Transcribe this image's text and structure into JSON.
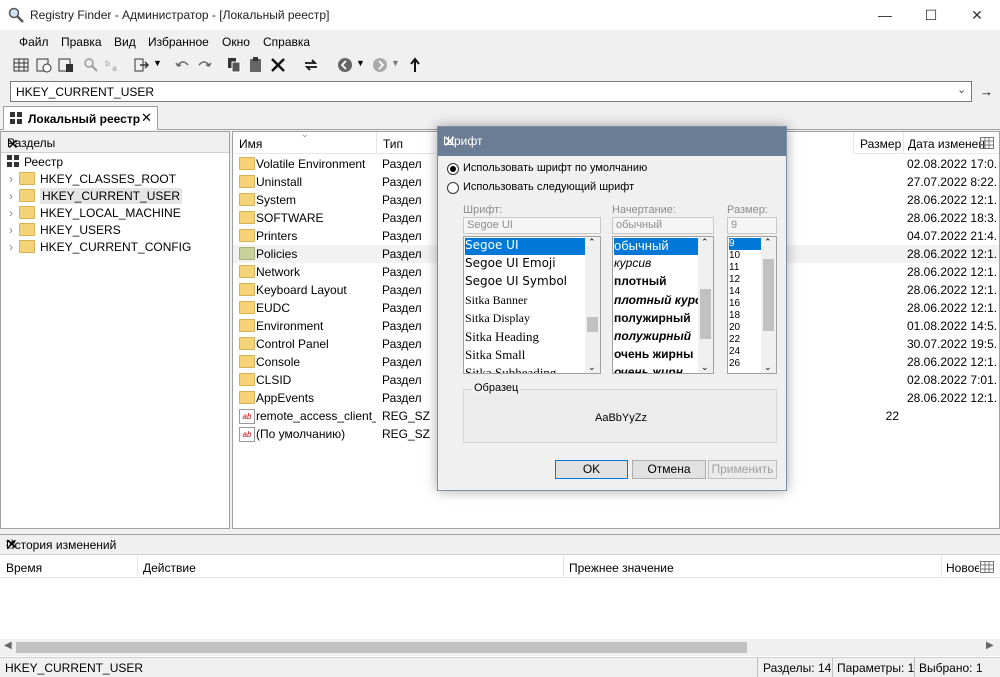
{
  "window": {
    "title": "Registry Finder - Администратор - [Локальный реестр]"
  },
  "menu": [
    "Файл",
    "Правка",
    "Вид",
    "Избранное",
    "Окно",
    "Справка"
  ],
  "address": {
    "value": "HKEY_CURRENT_USER"
  },
  "tab": {
    "label": "Локальный реестр"
  },
  "tree": {
    "header": "Разделы",
    "root": "Реестр",
    "items": [
      "HKEY_CLASSES_ROOT",
      "HKEY_CURRENT_USER",
      "HKEY_LOCAL_MACHINE",
      "HKEY_USERS",
      "HKEY_CURRENT_CONFIG"
    ]
  },
  "list": {
    "columns": {
      "name": "Имя",
      "type": "Тип",
      "size": "Размер",
      "date": "Дата изменен"
    },
    "rows": [
      {
        "name": "Volatile Environment",
        "type": "Раздел",
        "size": "",
        "date": "02.08.2022 17:0...",
        "icon": "folder"
      },
      {
        "name": "Uninstall",
        "type": "Раздел",
        "size": "",
        "date": "27.07.2022 8:22...",
        "icon": "folder"
      },
      {
        "name": "System",
        "type": "Раздел",
        "size": "",
        "date": "28.06.2022 12:1...",
        "icon": "folder"
      },
      {
        "name": "SOFTWARE",
        "type": "Раздел",
        "size": "",
        "date": "28.06.2022 18:3...",
        "icon": "folder"
      },
      {
        "name": "Printers",
        "type": "Раздел",
        "size": "",
        "date": "04.07.2022 21:4...",
        "icon": "folder"
      },
      {
        "name": "Policies",
        "type": "Раздел",
        "size": "",
        "date": "28.06.2022 12:1...",
        "icon": "folder-gray"
      },
      {
        "name": "Network",
        "type": "Раздел",
        "size": "",
        "date": "28.06.2022 12:1...",
        "icon": "folder"
      },
      {
        "name": "Keyboard Layout",
        "type": "Раздел",
        "size": "",
        "date": "28.06.2022 12:1...",
        "icon": "folder"
      },
      {
        "name": "EUDC",
        "type": "Раздел",
        "size": "",
        "date": "28.06.2022 12:1...",
        "icon": "folder"
      },
      {
        "name": "Environment",
        "type": "Раздел",
        "size": "",
        "date": "01.08.2022 14:5...",
        "icon": "folder"
      },
      {
        "name": "Control Panel",
        "type": "Раздел",
        "size": "",
        "date": "30.07.2022 19:5...",
        "icon": "folder"
      },
      {
        "name": "Console",
        "type": "Раздел",
        "size": "",
        "date": "28.06.2022 12:1...",
        "icon": "folder"
      },
      {
        "name": "CLSID",
        "type": "Раздел",
        "size": "",
        "date": "02.08.2022 7:01...",
        "icon": "folder"
      },
      {
        "name": "AppEvents",
        "type": "Раздел",
        "size": "",
        "date": "28.06.2022 12:1...",
        "icon": "folder"
      },
      {
        "name": "remote_access_client_id",
        "type": "REG_SZ",
        "size": "22",
        "date": "",
        "icon": "regsz"
      },
      {
        "name": "(По умолчанию)",
        "type": "REG_SZ",
        "size": "",
        "date": "",
        "icon": "regsz"
      }
    ]
  },
  "history": {
    "title": "История изменений",
    "columns": [
      "Время",
      "Действие",
      "Прежнее значение",
      "Новое"
    ]
  },
  "status": {
    "path": "HKEY_CURRENT_USER",
    "keys": "Разделы: 14",
    "params": "Параметры: 1",
    "selected": "Выбрано: 1"
  },
  "font_dialog": {
    "title": "Шрифт",
    "opt_default": "Использовать шрифт по умолчанию",
    "opt_custom": "Использовать следующий шрифт",
    "font_label": "Шрифт:",
    "font_value": "Segoe UI",
    "style_label": "Начертание:",
    "style_value": "обычный",
    "size_label": "Размер:",
    "size_value": "9",
    "fonts": [
      "Segoe UI",
      "Segoe UI Emoji",
      "Segoe UI Symbol",
      "Sitka Banner",
      "Sitka Display",
      "Sitka Heading",
      "Sitka Small",
      "Sitka Subheading"
    ],
    "styles": [
      "обычный",
      "курсив",
      "плотный",
      "плотный курс",
      "полужирный",
      "полужирный",
      "очень жирны",
      "очень жирн"
    ],
    "sizes": [
      "9",
      "10",
      "11",
      "12",
      "14",
      "16",
      "18",
      "20",
      "22",
      "24",
      "26"
    ],
    "sample_label": "Образец",
    "sample_text": "AaBbYyZz",
    "ok": "OK",
    "cancel": "Отмена",
    "apply": "Применить"
  }
}
